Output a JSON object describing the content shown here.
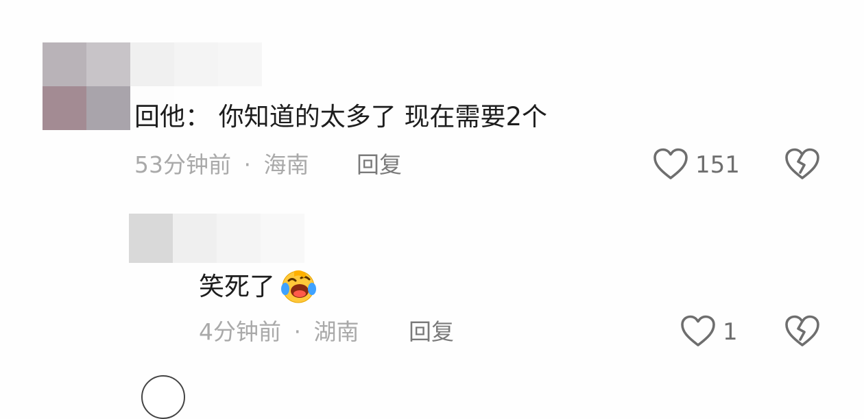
{
  "comments": [
    {
      "text": "回他： 你知道的太多了  现在需要2个",
      "time": "53分钟前",
      "separator": "·",
      "location": "海南",
      "reply_label": "回复",
      "like_count": "151"
    },
    {
      "text": "笑死了",
      "emoji": "laughing-face-emoji",
      "time": "4分钟前",
      "separator": "·",
      "location": "湖南",
      "reply_label": "回复",
      "like_count": "1"
    }
  ],
  "icons": {
    "like": "heart-outline-icon",
    "dislike": "broken-heart-icon"
  },
  "colors": {
    "text": "#1d1d1d",
    "meta": "#a9a9a9",
    "icon": "#6e6e6e"
  }
}
